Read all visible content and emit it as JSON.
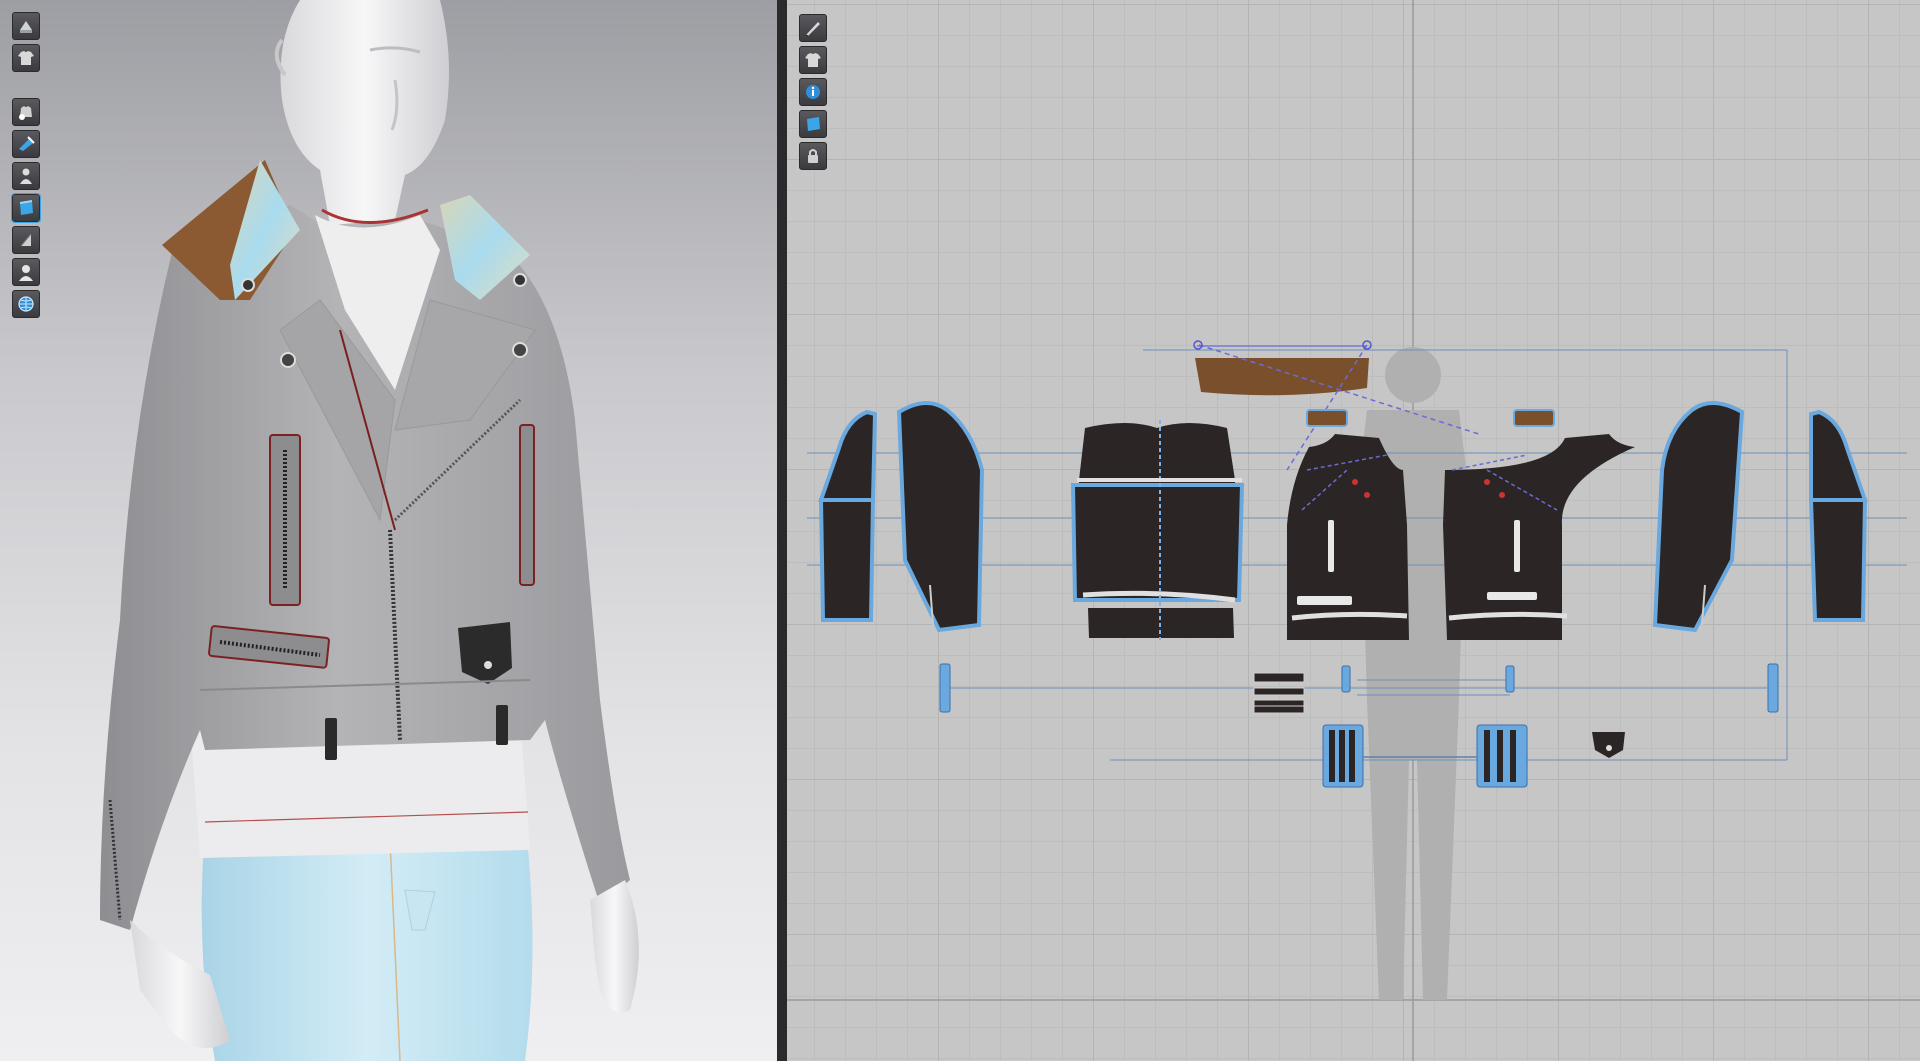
{
  "app": {
    "panels": [
      "3d-garment-window",
      "2d-pattern-window"
    ]
  },
  "toolbar3d": {
    "tools": [
      {
        "icon": "simulation-icon"
      },
      {
        "icon": "garment-icon"
      },
      {
        "icon": "show-avatar-icon"
      },
      {
        "icon": "texture-icon"
      },
      {
        "icon": "avatar-pose-icon"
      },
      {
        "icon": "surface-mode-icon"
      },
      {
        "icon": "mesh-mode-icon"
      },
      {
        "icon": "avatar-display-icon"
      },
      {
        "icon": "globe-icon"
      }
    ]
  },
  "toolbar2d": {
    "tools": [
      {
        "icon": "edit-pattern-icon"
      },
      {
        "icon": "garment-view-icon"
      },
      {
        "icon": "info-icon"
      },
      {
        "icon": "texture-view-icon"
      },
      {
        "icon": "lock-icon"
      }
    ]
  },
  "colors": {
    "accent": "#3aa6e8",
    "pattern_fill": "#2b2625",
    "pattern_outline": "#6aa8e0",
    "collar_leather": "#7a4f2b",
    "seam_line": "#8a2020",
    "jacket": "#a9a9ab",
    "jeans": "#bfe1ef"
  }
}
